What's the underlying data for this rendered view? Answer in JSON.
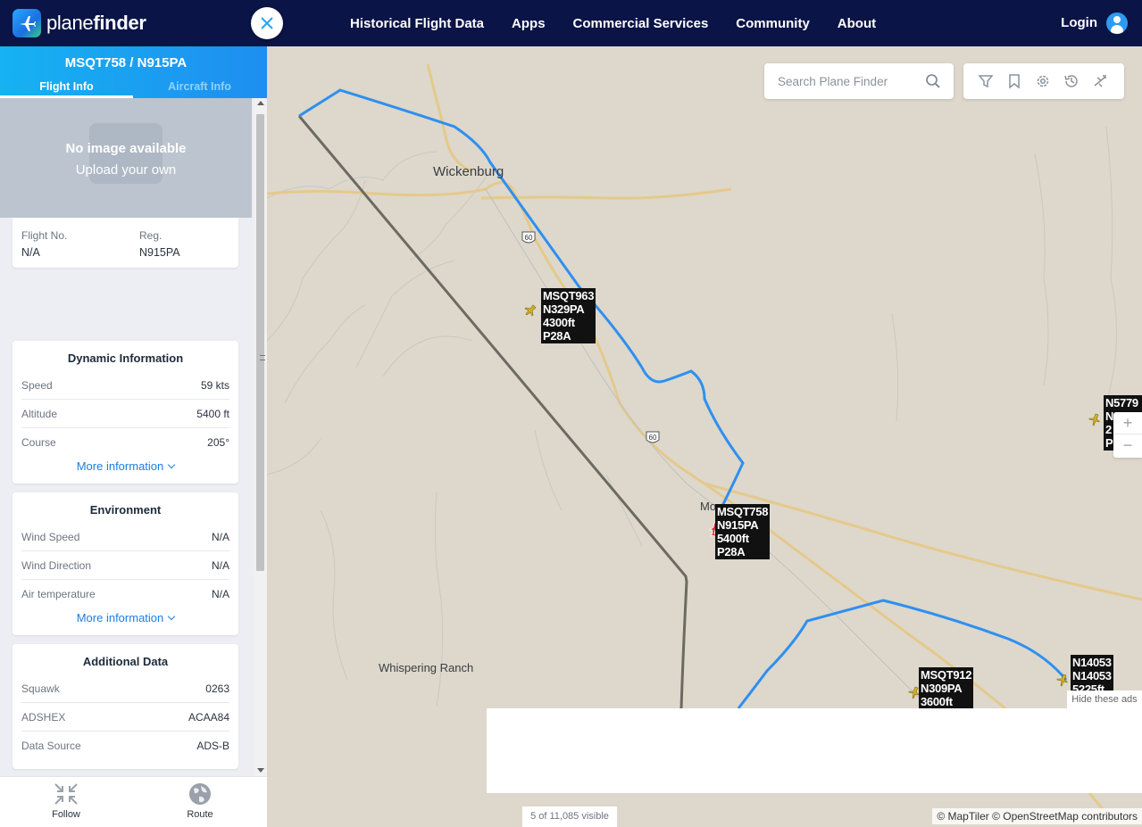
{
  "nav": {
    "brand_plain": "plane",
    "brand_bold": "finder",
    "links": [
      "Historical Flight Data",
      "Apps",
      "Commercial Services",
      "Community",
      "About"
    ],
    "login": "Login"
  },
  "panel": {
    "title": "MSQT758 / N915PA",
    "tabs": [
      "Flight Info",
      "Aircraft Info"
    ],
    "no_image_title": "No image available",
    "no_image_sub": "Upload your own",
    "flight_no_label": "Flight No.",
    "flight_no_value": "N/A",
    "reg_label": "Reg.",
    "reg_value": "N915PA",
    "dynamic": {
      "title": "Dynamic Information",
      "rows": [
        {
          "k": "Speed",
          "v": "59 kts"
        },
        {
          "k": "Altitude",
          "v": "5400 ft"
        },
        {
          "k": "Course",
          "v": "205°"
        }
      ],
      "more": "More information"
    },
    "environment": {
      "title": "Environment",
      "rows": [
        {
          "k": "Wind Speed",
          "v": "N/A"
        },
        {
          "k": "Wind Direction",
          "v": "N/A"
        },
        {
          "k": "Air temperature",
          "v": "N/A"
        }
      ],
      "more": "More information"
    },
    "additional": {
      "title": "Additional Data",
      "rows": [
        {
          "k": "Squawk",
          "v": "0263"
        },
        {
          "k": "ADSHEX",
          "v": "ACAA84"
        },
        {
          "k": "Data Source",
          "v": "ADS-B"
        }
      ]
    },
    "footer": {
      "follow": "Follow",
      "route": "Route"
    }
  },
  "map": {
    "search_placeholder": "Search Plane Finder",
    "places": {
      "wickenburg": "Wickenburg",
      "whispering": "Whispering Ranch",
      "morristown": "Mor",
      "route60": "60"
    },
    "labels": {
      "msqt963": [
        "MSQT963",
        "N329PA",
        "4300ft",
        "P28A"
      ],
      "msqt758": [
        "MSQT758",
        "N915PA",
        "5400ft",
        "P28A"
      ],
      "msqt912": [
        "MSQT912",
        "N309PA",
        "3600ft"
      ],
      "n5779": [
        "N5779",
        "N",
        "2",
        "P"
      ],
      "n14053": [
        "N14053",
        "N14053",
        "5225ft"
      ]
    },
    "zoom_in": "+",
    "zoom_out": "−",
    "hide_ads": "Hide these ads",
    "visible_count": "5 of 11,085 visible",
    "attribution": "© MapTiler © OpenStreetMap contributors"
  }
}
